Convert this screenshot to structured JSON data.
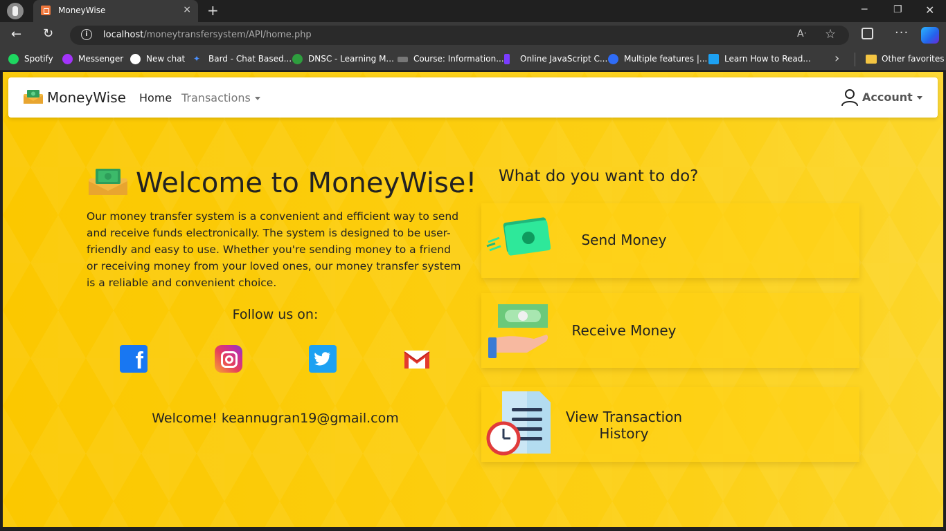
{
  "browser": {
    "tab_title": "MoneyWise",
    "tab_close": "×",
    "new_tab": "+",
    "url_host": "localhost",
    "url_path": "/moneytransfersystem/API/home.php",
    "favorites": [
      {
        "label": "Spotify",
        "color": "#1ed760"
      },
      {
        "label": "Messenger",
        "color": "#a334fa"
      },
      {
        "label": "New chat",
        "color": "#ffffff"
      },
      {
        "label": "Bard - Chat Based...",
        "color": "#4a90ff"
      },
      {
        "label": "DNSC - Learning M...",
        "color": "#2e9e3e"
      },
      {
        "label": "Course: Information...",
        "color": "#888888"
      },
      {
        "label": "Online JavaScript C...",
        "color": "#7a3cff"
      },
      {
        "label": "Multiple features |...",
        "color": "#2f6cf6"
      },
      {
        "label": "Learn How to Read...",
        "color": "#1da1f2"
      }
    ],
    "other_favorites": "Other favorites"
  },
  "nav": {
    "brand": "MoneyWise",
    "home": "Home",
    "transactions": "Transactions",
    "account": "Account"
  },
  "hero": {
    "title": "Welcome to MoneyWise!",
    "intro": "Our money transfer system is a convenient and efficient way to send and receive funds electronically. The system is designed to be user-friendly and easy to use. Whether you're sending money to a friend or receiving money from your loved ones, our money transfer system is a reliable and convenient choice.",
    "follow": "Follow us on:",
    "welcome_user": "Welcome! keannugran19@gmail.com"
  },
  "social": [
    "facebook-icon",
    "instagram-icon",
    "twitter-icon",
    "gmail-icon"
  ],
  "actions": {
    "question": "What do you want to do?",
    "send": "Send Money",
    "receive": "Receive Money",
    "history": "View Transaction History"
  },
  "colors": {
    "page_bg": "#fbc800",
    "accent_green": "#2ed68a",
    "facebook": "#1877f2",
    "twitter": "#1da1f2"
  }
}
